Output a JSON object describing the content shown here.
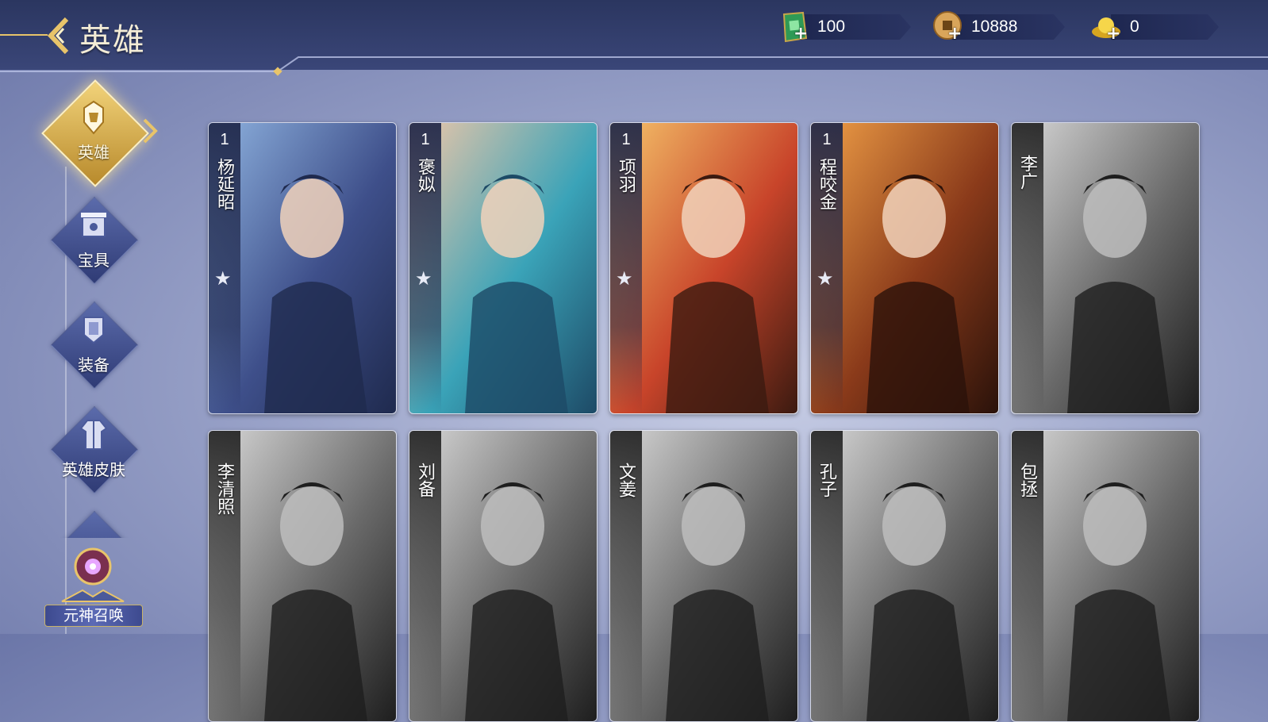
{
  "header": {
    "title": "英雄"
  },
  "currencies": [
    {
      "icon": "jade-token-icon",
      "value": "100"
    },
    {
      "icon": "copper-coin-icon",
      "value": "10888"
    },
    {
      "icon": "gold-ingot-icon",
      "value": "0"
    }
  ],
  "sidebar": {
    "items": [
      {
        "label": "英雄",
        "icon": "hero-helmet-icon",
        "active": true
      },
      {
        "label": "宝具",
        "icon": "treasure-chest-icon",
        "active": false
      },
      {
        "label": "装备",
        "icon": "armor-icon",
        "active": false
      },
      {
        "label": "英雄皮肤",
        "icon": "robe-icon",
        "active": false
      }
    ],
    "summon_label": "元神召唤"
  },
  "heroes": [
    {
      "name": "杨延昭",
      "level": "1",
      "owned": true
    },
    {
      "name": "褒姒",
      "level": "1",
      "owned": true
    },
    {
      "name": "项羽",
      "level": "1",
      "owned": true
    },
    {
      "name": "程咬金",
      "level": "1",
      "owned": true
    },
    {
      "name": "李广",
      "owned": false
    },
    {
      "name": "李清照",
      "owned": false
    },
    {
      "name": "刘备",
      "owned": false
    },
    {
      "name": "文姜",
      "owned": false
    },
    {
      "name": "孔子",
      "owned": false
    },
    {
      "name": "包拯",
      "owned": false
    }
  ],
  "colors": {
    "accent_gold": "#e8c46a",
    "topbar": "#2b3660"
  }
}
